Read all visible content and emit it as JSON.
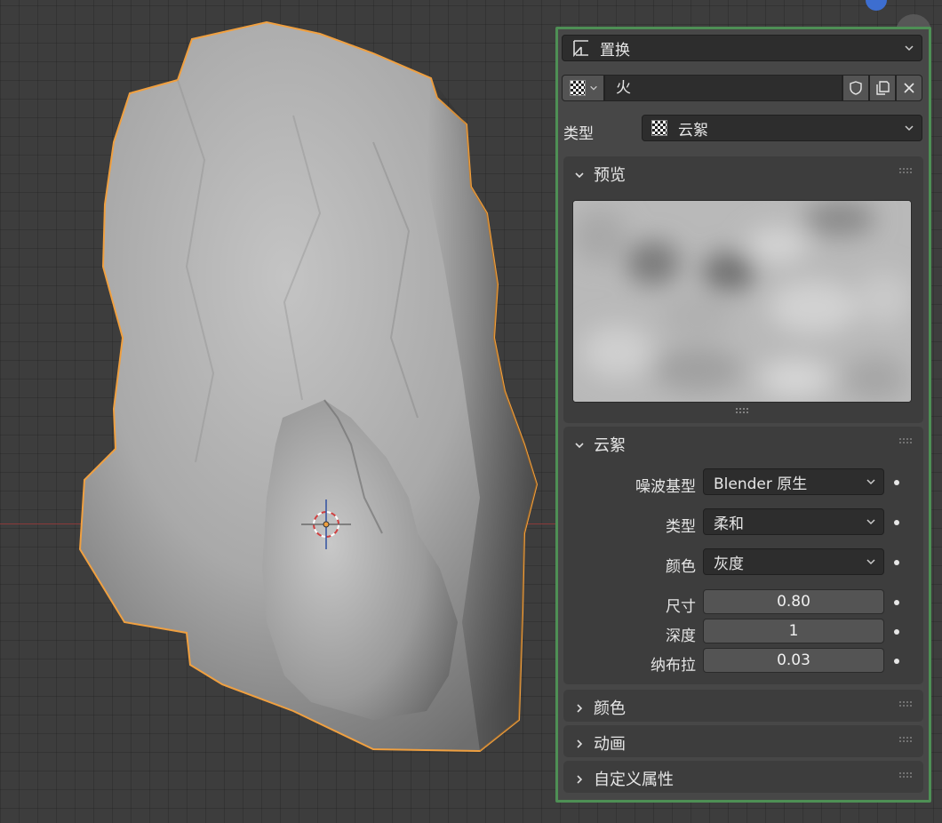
{
  "modifier": {
    "name": "置换",
    "icon": "displace-modifier-icon"
  },
  "texture": {
    "name": "火",
    "icon": "checker-texture-icon"
  },
  "type_row": {
    "label": "类型",
    "value": "云絮"
  },
  "preview": {
    "title": "预览"
  },
  "clouds": {
    "title": "云絮",
    "noise_basis": {
      "label": "噪波基型",
      "value": "Blender 原生"
    },
    "noise_type": {
      "label": "类型",
      "value": "柔和"
    },
    "color": {
      "label": "颜色",
      "value": "灰度"
    },
    "size": {
      "label": "尺寸",
      "value": "0.80"
    },
    "depth": {
      "label": "深度",
      "value": "1"
    },
    "nabla": {
      "label": "纳布拉",
      "value": "0.03"
    }
  },
  "collapsed_sections": [
    {
      "title": "颜色"
    },
    {
      "title": "动画"
    },
    {
      "title": "自定义属性"
    }
  ],
  "colors": {
    "selection_outline": "#f0a040",
    "panel_border": "#4e8f55",
    "panel_bg": "#474747"
  }
}
